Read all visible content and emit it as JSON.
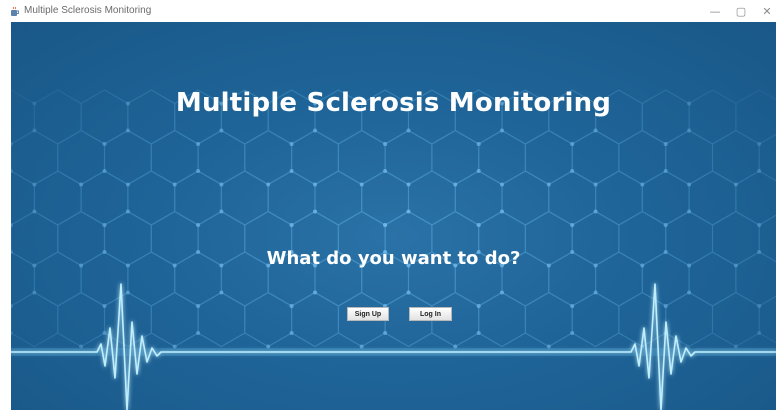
{
  "window": {
    "title": "Multiple Sclerosis Monitoring",
    "icons": {
      "app": "java-cup-icon",
      "minimize": "minimize-icon",
      "maximize": "maximize-icon",
      "close": "close-icon"
    },
    "controls": {
      "minimize": "—",
      "maximize": "▢",
      "close": "✕"
    }
  },
  "main": {
    "title": "Multiple Sclerosis Monitoring",
    "question": "What do you want to do?",
    "buttons": {
      "signup": "Sign Up",
      "login": "Log In"
    }
  },
  "colors": {
    "background": "#1f6498",
    "heartbeat": "#9fe0ff",
    "hexagon": "#4b98cc",
    "text": "#ffffff"
  }
}
